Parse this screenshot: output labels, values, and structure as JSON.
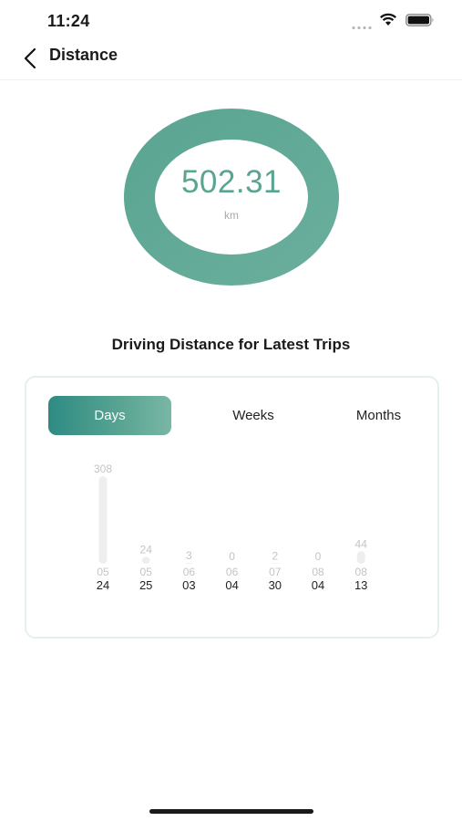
{
  "status_bar": {
    "time": "11:24"
  },
  "nav": {
    "title": "Distance"
  },
  "summary": {
    "value": "502.31",
    "unit": "km",
    "color": "#5aa592"
  },
  "section": {
    "title": "Driving Distance for Latest Trips"
  },
  "tabs": [
    {
      "label": "Days",
      "active": true
    },
    {
      "label": "Weeks",
      "active": false
    },
    {
      "label": "Months",
      "active": false
    }
  ],
  "chart_data": {
    "type": "bar",
    "categories": [
      {
        "month": "05",
        "day": "24"
      },
      {
        "month": "05",
        "day": "25"
      },
      {
        "month": "06",
        "day": "03"
      },
      {
        "month": "06",
        "day": "04"
      },
      {
        "month": "07",
        "day": "30"
      },
      {
        "month": "08",
        "day": "04"
      },
      {
        "month": "08",
        "day": "13"
      }
    ],
    "values": [
      308,
      24,
      3,
      0,
      2,
      0,
      44
    ],
    "bar_color": "#eeeeee"
  }
}
